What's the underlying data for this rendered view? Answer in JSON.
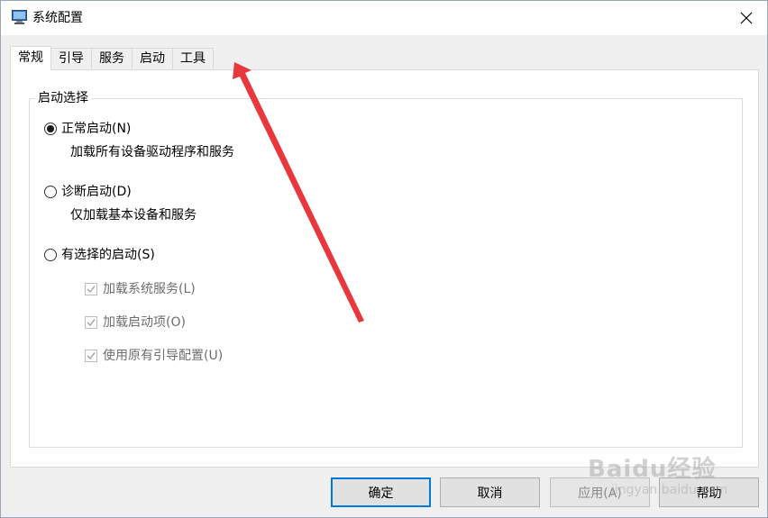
{
  "window": {
    "title": "系统配置",
    "close_glyph": "✕"
  },
  "tabs": [
    {
      "label": "常规",
      "active": true
    },
    {
      "label": "引导",
      "active": false
    },
    {
      "label": "服务",
      "active": false
    },
    {
      "label": "启动",
      "active": false
    },
    {
      "label": "工具",
      "active": false
    }
  ],
  "startup_group": {
    "label": "启动选择",
    "options": [
      {
        "label": "正常启动(N)",
        "description": "加载所有设备驱动程序和服务",
        "checked": true
      },
      {
        "label": "诊断启动(D)",
        "description": "仅加载基本设备和服务",
        "checked": false
      },
      {
        "label": "有选择的启动(S)",
        "checked": false
      }
    ],
    "checkboxes": [
      {
        "label": "加载系统服务(L)",
        "checked": true,
        "disabled": true
      },
      {
        "label": "加载启动项(O)",
        "checked": true,
        "disabled": true
      },
      {
        "label": "使用原有引导配置(U)",
        "checked": true,
        "disabled": true
      }
    ]
  },
  "buttons": {
    "ok": "确定",
    "cancel": "取消",
    "apply": "应用(A)",
    "help": "帮助"
  },
  "watermark": {
    "brand": "Baidu经验",
    "url": "jingyan.baidu.com"
  },
  "colors": {
    "accent": "#0078d7",
    "annotation_arrow": "#e8383d"
  }
}
